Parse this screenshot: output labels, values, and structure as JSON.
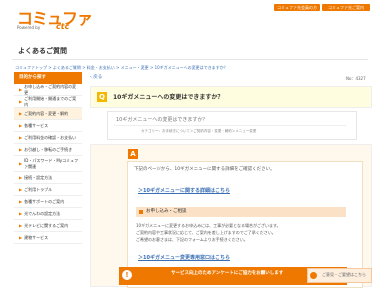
{
  "header": {
    "logo": "コミュファ",
    "logo_tagline": "Powered by",
    "logo_brand": "ctc",
    "buttons": [
      "コミュファ光会員の方",
      "コミュファ光ご案内"
    ]
  },
  "page_title": "よくあるご質問",
  "breadcrumb": "コミュファトップ > よくあるご質問 > 料金・お支払い > メニュー・変更 > 10ギガメニューへの変更はできますか？",
  "sidebar": {
    "heading": "目的から探す",
    "items": [
      "お申し込み・ご契約内容の変更",
      "ご利用開始・開通までのご案内",
      "ご契約内容・変更・解約",
      "各種サービス",
      "ご利用料金の確認・お支払い",
      "お引越し・移転のご手続き",
      "ID・パスワード・Myコミュファ関連",
      "接続・設定方法",
      "ご利用トラブル",
      "各種サポートのご案内",
      "光でんわの設定方法",
      "光テレビに関するご案内",
      "建物サービス"
    ]
  },
  "content": {
    "back": "戻る",
    "question_no": "No：4327",
    "question_badge": "Q",
    "question": "10ギガメニューへの変更はできますか？",
    "question_body": "10ギガメニューへの変更はできますか？",
    "category": "カテゴリー：お手続きについて＞ご契約内容・変更・解約＞メニュー変更",
    "answer_badge": "A",
    "answer_line1": "下記のページから、10ギガメニューに関する詳細をご確認ください。",
    "answer_link1": "＞10ギガメニューに関する詳細はこちら",
    "note_heading": "お申し込み・ご相談",
    "note_lines": [
      "10ギガメニューに変更するお申込みには、工事が必要となる場合がございます。",
      "ご契約内容や工事状況に応じて、ご案内を差し上げますのでご了承ください。",
      "ご希望のお客さまは、下記のフォームよりお手続きください。"
    ],
    "answer_link2": "＞10ギガメニュー変更専用窓口はこちら"
  },
  "survey": {
    "icon": "!",
    "text": "サービス向上のためアンケートにご協力をお願いします"
  },
  "feedback": {
    "text": "ご意見・ご要望はこちら"
  }
}
